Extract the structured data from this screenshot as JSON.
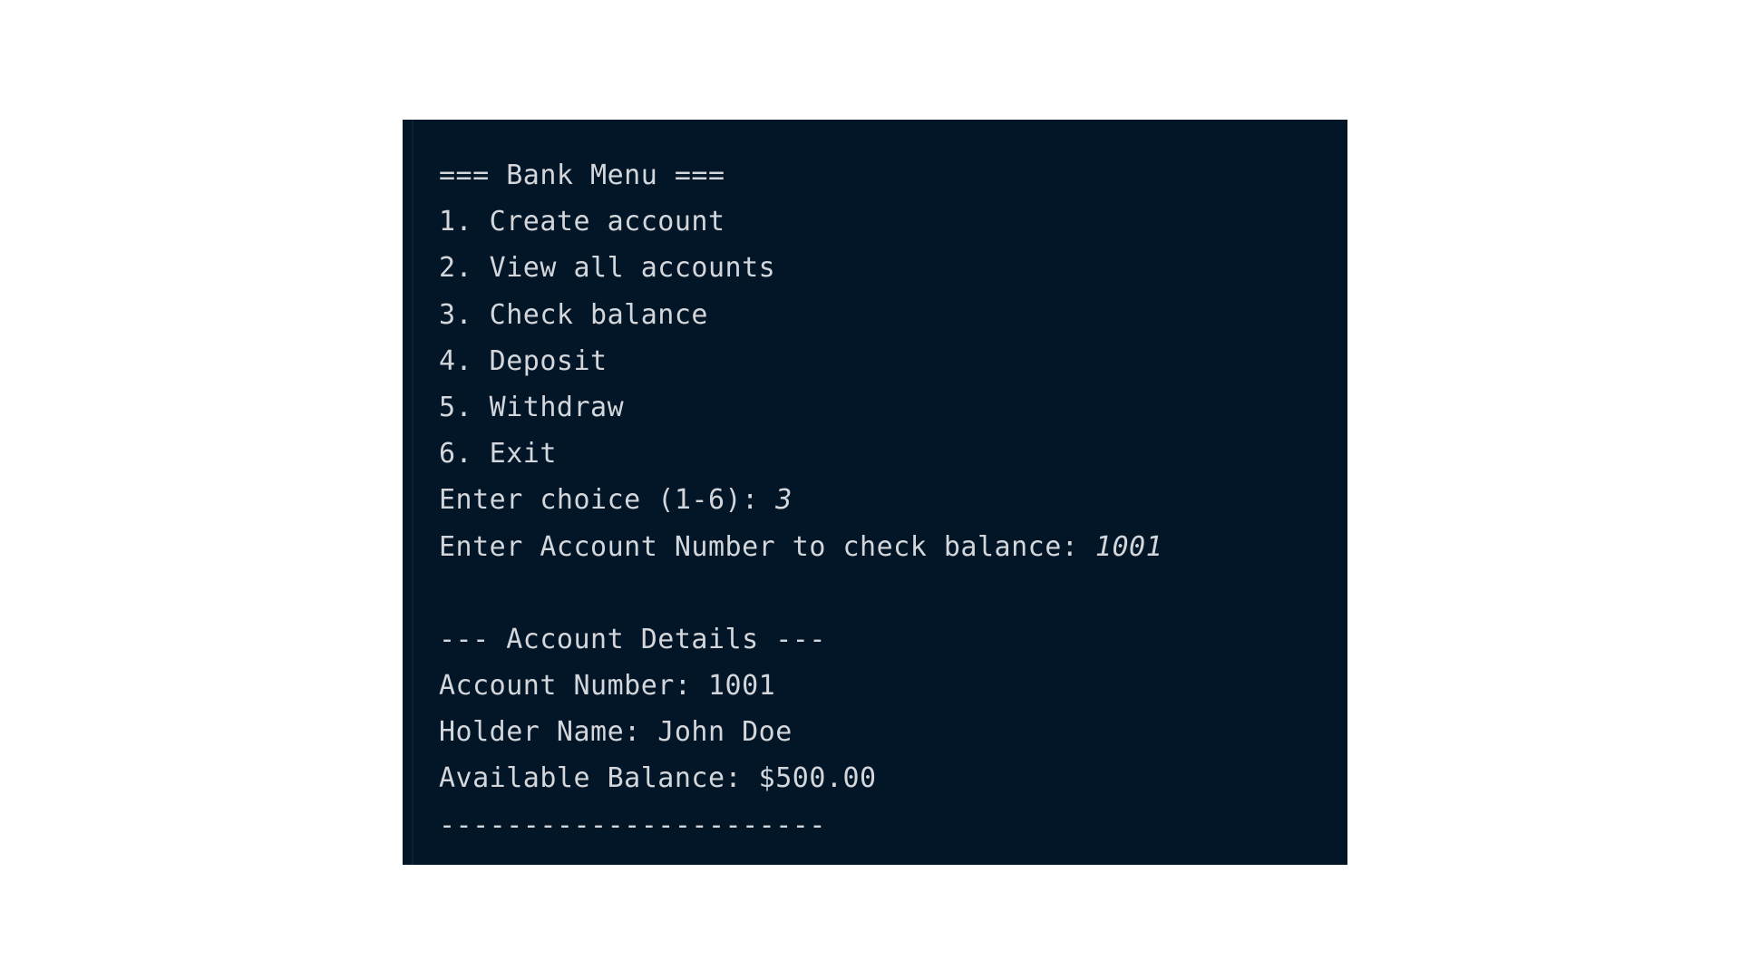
{
  "console": {
    "lines": {
      "menu_header": "=== Bank Menu ===",
      "opt1": "1. Create account",
      "opt2": "2. View all accounts",
      "opt3": "3. Check balance",
      "opt4": "4. Deposit",
      "opt5": "5. Withdraw",
      "opt6": "6. Exit",
      "choice_prompt": "Enter choice (1-6): ",
      "choice_input": "3",
      "account_prompt": "Enter Account Number to check balance: ",
      "account_input": "1001",
      "details_header": "--- Account Details ---",
      "account_number": "Account Number: 1001",
      "holder_name": "Holder Name: John Doe",
      "available_balance": "Available Balance: $500.00",
      "footer_rule": "-----------------------"
    }
  },
  "colors": {
    "background": "#031627",
    "text": "#d3d7dc"
  }
}
